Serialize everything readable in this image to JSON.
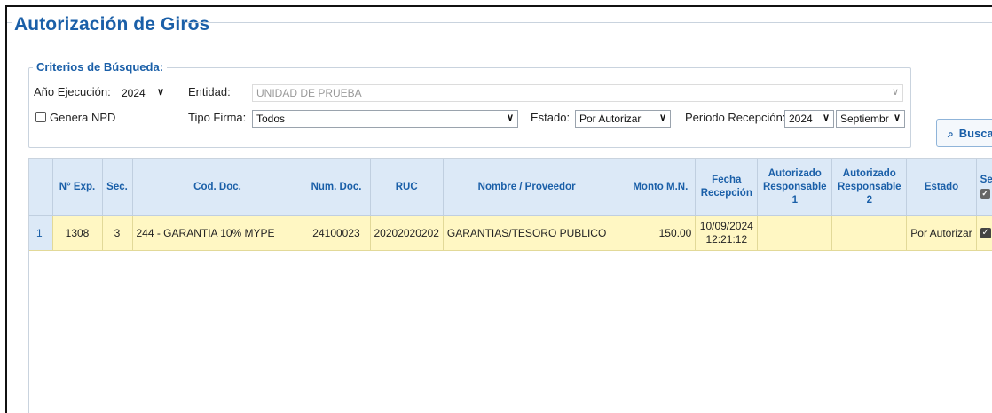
{
  "page": {
    "title": "Autorización de Giros"
  },
  "criteria": {
    "legend": "Criterios de Búsqueda:",
    "anio_ejecucion_label": "Año Ejecución:",
    "anio_ejecucion_value": "2024",
    "entidad_label": "Entidad:",
    "entidad_value": "UNIDAD DE PRUEBA",
    "genera_npd_label": "Genera NPD",
    "tipo_firma_label": "Tipo Firma:",
    "tipo_firma_value": "Todos",
    "estado_label": "Estado:",
    "estado_value": "Por Autorizar",
    "periodo_label": "Periodo Recepción:",
    "periodo_anio_value": "2024",
    "periodo_mes_value": "Septiembr"
  },
  "buttons": {
    "buscar_label": "Busca"
  },
  "table": {
    "headers": {
      "nexp": "N° Exp.",
      "sec": "Sec.",
      "coddoc": "Cod. Doc.",
      "numdoc": "Num. Doc.",
      "ruc": "RUC",
      "nombre": "Nombre / Proveedor",
      "monto": "Monto M.N.",
      "fecha_l1": "Fecha",
      "fecha_l2": "Recepción",
      "aut1_l1": "Autorizado",
      "aut1_l2": "Responsable",
      "aut1_l3": "1",
      "aut2_l1": "Autorizado",
      "aut2_l2": "Responsable",
      "aut2_l3": "2",
      "estado": "Estado",
      "sel": "Se"
    },
    "rows": [
      {
        "rownum": "1",
        "nexp": "1308",
        "sec": "3",
        "coddoc": "244 - GARANTIA 10% MYPE",
        "numdoc": "24100023",
        "ruc": "20202020202",
        "nombre": "GARANTIAS/TESORO PUBLICO",
        "monto": "150.00",
        "fecha_date": "10/09/2024",
        "fecha_time": "12:21:12",
        "aut1": "",
        "aut2": "",
        "estado": "Por Autorizar"
      }
    ]
  },
  "icons": {
    "dropdown": "chevron-down-icon",
    "search": "magnifier-icon",
    "check": "checkmark-icon"
  },
  "colors": {
    "accent": "#1a5fa8",
    "header_bg": "#dce9f7",
    "row_highlight": "#fff7c3"
  }
}
